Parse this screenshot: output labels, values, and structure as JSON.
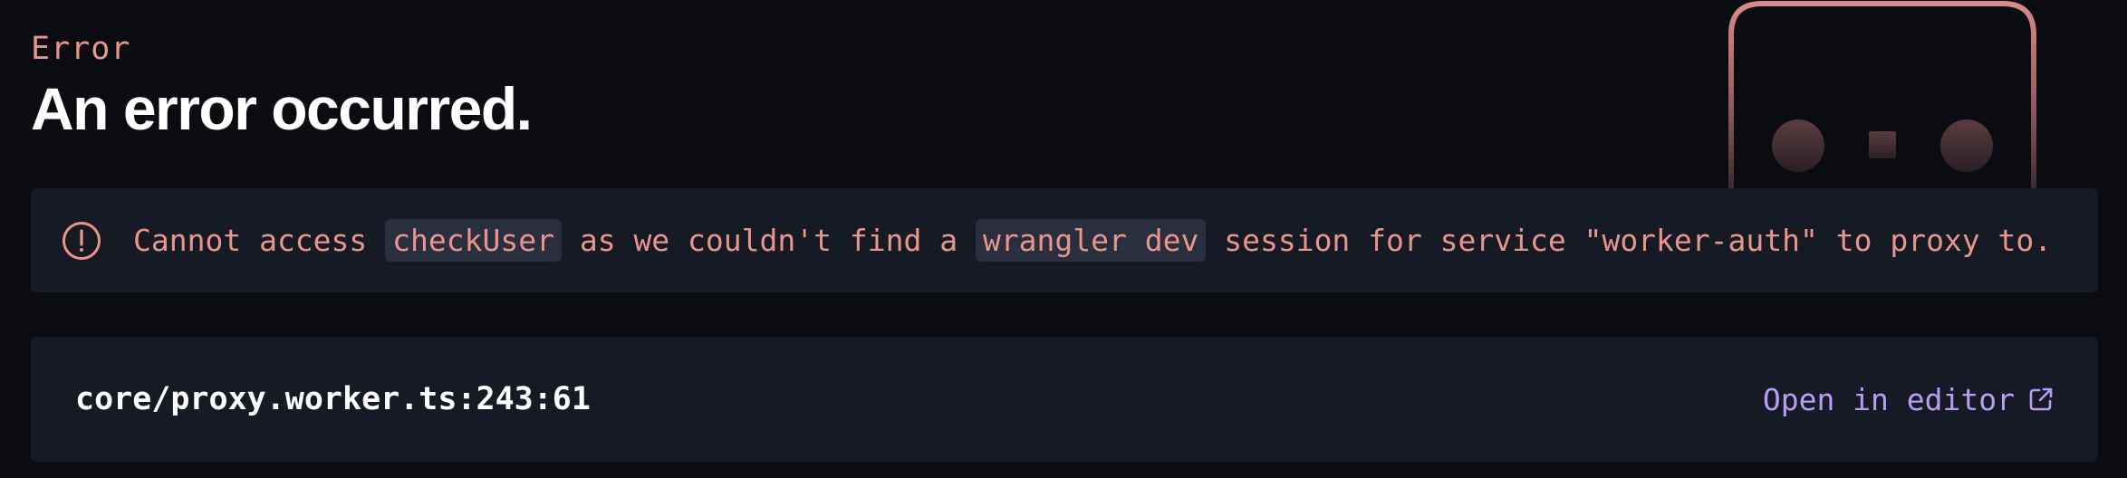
{
  "header": {
    "eyebrow": "Error",
    "title": "An error occurred."
  },
  "alert": {
    "icon": "alert-circle-icon",
    "text_before": "Cannot access ",
    "code_1": "checkUser",
    "text_middle": " as we couldn't find a ",
    "code_2": "wrangler dev",
    "text_after": " session for service \"worker-auth\" to proxy to."
  },
  "location_bar": {
    "location": "core/proxy.worker.ts:243:61",
    "open_label": "Open in editor",
    "open_icon": "external-link-icon"
  },
  "illustration": {
    "icon": "robot-face-icon"
  },
  "colors": {
    "background": "#0b0c12",
    "panel": "#161a25",
    "error_text": "#e8958c",
    "link": "#b99cf3",
    "code_bg": "#2a2f40",
    "title": "#ffffff"
  }
}
